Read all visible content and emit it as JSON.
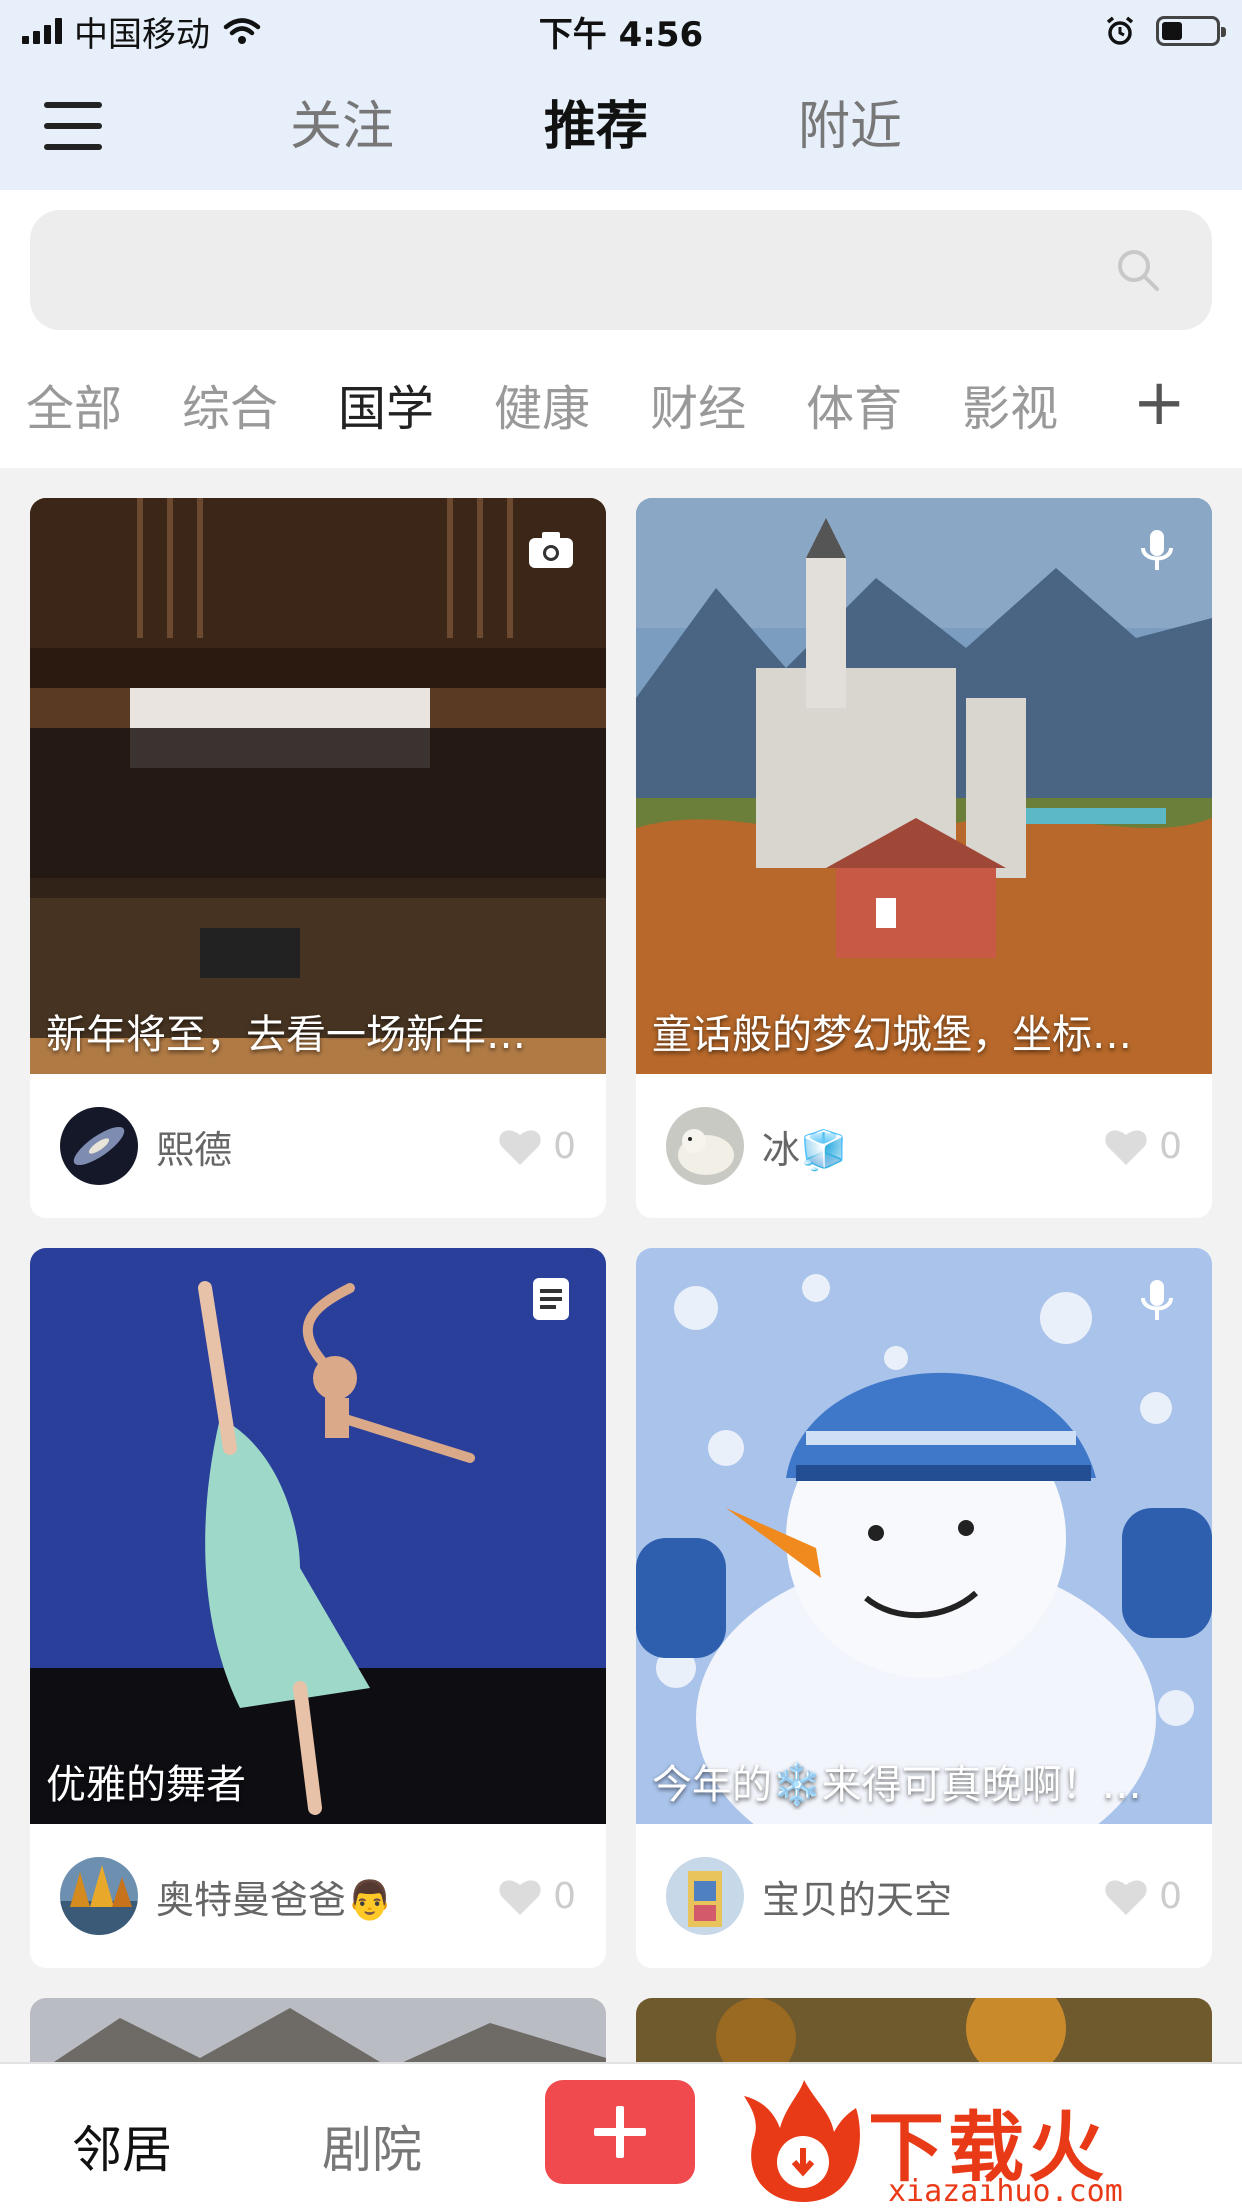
{
  "status_bar": {
    "carrier": "中国移动",
    "time": "下午 4:56"
  },
  "top_nav": {
    "tabs": [
      {
        "label": "关注"
      },
      {
        "label": "推荐"
      },
      {
        "label": "附近"
      }
    ],
    "active_tab": "推荐"
  },
  "search": {
    "placeholder": ""
  },
  "categories": {
    "items": [
      {
        "label": "全部"
      },
      {
        "label": "综合"
      },
      {
        "label": "国学"
      },
      {
        "label": "健康"
      },
      {
        "label": "财经"
      },
      {
        "label": "体育"
      },
      {
        "label": "影视"
      }
    ],
    "active": "国学",
    "add_label": "+"
  },
  "feed": {
    "cards": [
      {
        "title": "新年将至，去看一场新年…",
        "author": "熙德",
        "likes": "0",
        "media_icon": "camera-icon"
      },
      {
        "title": "童话般的梦幻城堡，坐标…",
        "author": "冰🧊",
        "likes": "0",
        "media_icon": "microphone-icon"
      },
      {
        "title": "优雅的舞者",
        "author": "奥特曼爸爸👨",
        "likes": "0",
        "media_icon": "article-icon"
      },
      {
        "title": "今年的❄️来得可真晚啊！…",
        "author": "宝贝的天空",
        "likes": "0",
        "media_icon": "microphone-icon"
      }
    ]
  },
  "bottom_bar": {
    "tabs": [
      {
        "label": "邻居"
      },
      {
        "label": "剧院"
      }
    ],
    "active_tab": "邻居",
    "watermark_text": "下载火",
    "watermark_url": "xiazaihuo.com"
  },
  "colors": {
    "accent": "#f04a4f",
    "header_bg": "#e6effa",
    "watermark": "#e93a18"
  }
}
